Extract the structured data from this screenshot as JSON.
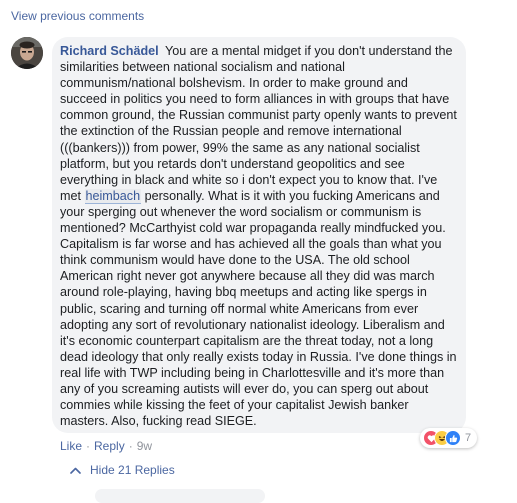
{
  "thread": {
    "view_previous": "View previous comments"
  },
  "comment": {
    "author": "Richard Schädel",
    "text_before_mention": "You are a mental midget if you don't understand the similarities between national socialism and national communism/national bolshevism. In order to make ground and succeed in politics you need to form alliances in with groups that have common ground, the Russian communist party openly wants to prevent the extinction of the Russian people and remove international (((bankers))) from power, 99% the same as any national socialist platform, but you retards don't understand geopolitics and see everything in black and white so i don't expect you to know that. I've met",
    "mention": "heimbach",
    "text_after_mention": "personally. What is it with you fucking Americans and your sperging out whenever the word socialism or communism is mentioned? McCarthyist cold war propaganda really mindfucked you. Capitalism is far worse and has achieved all the goals than what you think communism would have done to the USA. The old school American right never got anywhere because all they did was march around role-playing, having bbq meetups and acting like spergs in public, scaring and turning off normal white Americans from ever adopting any sort of revolutionary nationalist ideology. Liberalism and it's economic counterpart capitalism are the threat today, not a long dead ideology that only really exists today in Russia. I've done things in real life with TWP including being in Charlottesville and it's more than any of you screaming autists will ever do, you can sperg out about commies while kissing the feet of your capitalist Jewish banker masters. Also, fucking read SIEGE.",
    "reactions": {
      "icons": [
        "love-icon",
        "haha-icon",
        "like-icon"
      ],
      "colors": {
        "love": "#f25268",
        "haha": "#fbcd45",
        "like": "#2e81f7"
      },
      "count": "7"
    },
    "actions": {
      "like": "Like",
      "reply": "Reply",
      "age": "9w"
    }
  },
  "replies": {
    "hide_label": "Hide 21 Replies"
  }
}
